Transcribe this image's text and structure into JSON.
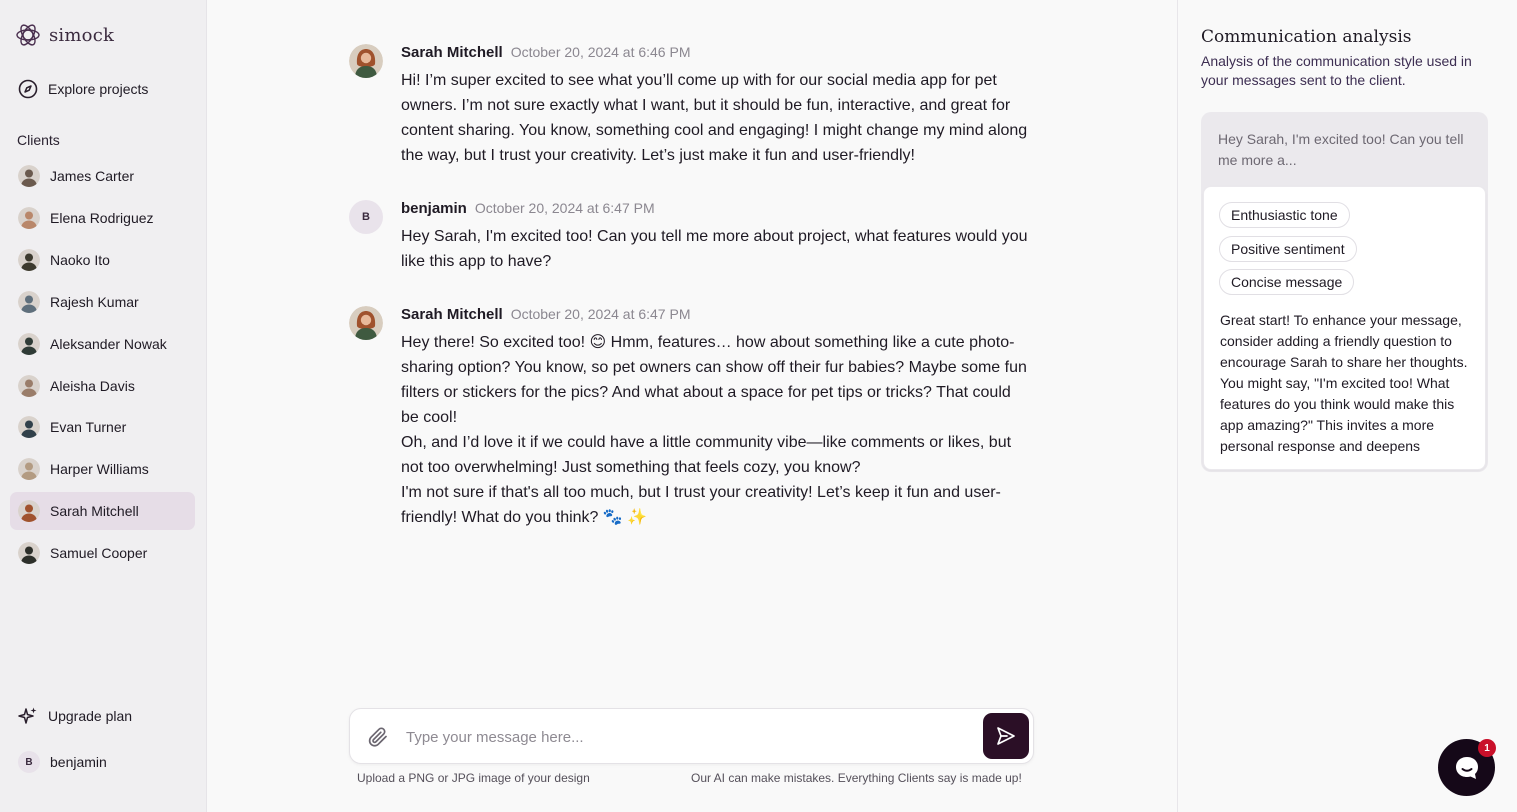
{
  "app": {
    "name": "simock"
  },
  "nav": {
    "explore": "Explore projects",
    "upgrade": "Upgrade plan",
    "user_initial": "B",
    "user_name": "benjamin"
  },
  "clients_label": "Clients",
  "clients": [
    {
      "name": "James Carter",
      "active": false,
      "color": "#6b5a4e"
    },
    {
      "name": "Elena Rodriguez",
      "active": false,
      "color": "#b9876a"
    },
    {
      "name": "Naoko Ito",
      "active": false,
      "color": "#3d3a2e"
    },
    {
      "name": "Rajesh Kumar",
      "active": false,
      "color": "#5f6f7c"
    },
    {
      "name": "Aleksander Nowak",
      "active": false,
      "color": "#2f3b36"
    },
    {
      "name": "Aleisha Davis",
      "active": false,
      "color": "#9a7d6a"
    },
    {
      "name": "Evan Turner",
      "active": false,
      "color": "#31404a"
    },
    {
      "name": "Harper Williams",
      "active": false,
      "color": "#b39b82"
    },
    {
      "name": "Sarah Mitchell",
      "active": true,
      "color": "#a0522d"
    },
    {
      "name": "Samuel Cooper",
      "active": false,
      "color": "#2d2f2a"
    }
  ],
  "messages": [
    {
      "sender": "Sarah Mitchell",
      "time": "October 20, 2024 at 6:46 PM",
      "avatar": "photo",
      "paragraphs": [
        "Hi! I’m super excited to see what you’ll come up with for our social media app for pet owners. I’m not sure exactly what I want, but it should be fun, interactive, and great for content sharing. You know, something cool and engaging! I might change my mind along the way, but I trust your creativity. Let’s just make it fun and user-friendly!"
      ]
    },
    {
      "sender": "benjamin",
      "time": "October 20, 2024 at 6:47 PM",
      "avatar": "initial",
      "initial": "B",
      "paragraphs": [
        "Hey Sarah, I'm excited too! Can you tell me more about project, what features would you like this app to have?"
      ]
    },
    {
      "sender": "Sarah Mitchell",
      "time": "October 20, 2024 at 6:47 PM",
      "avatar": "photo",
      "paragraphs": [
        "Hey there! So excited too! 😊 Hmm, features… how about something like a cute photo-sharing option? You know, so pet owners can show off their fur babies? Maybe some fun filters or stickers for the pics? And what about a space for pet tips or tricks? That could be cool!",
        "Oh, and I’d love it if we could have a little community vibe—like comments or likes, but not too overwhelming! Just something that feels cozy, you know?",
        "I'm not sure if that's all too much, but I trust your creativity! Let’s keep it fun and user-friendly! What do you think? 🐾 ✨"
      ]
    }
  ],
  "composer": {
    "placeholder": "Type your message here...",
    "hint_left": "Upload a PNG or JPG image of your design",
    "hint_right": "Our AI can make mistakes. Everything Clients say is made up!"
  },
  "analysis": {
    "title": "Communication analysis",
    "subtitle": "Analysis of the communication style used in your messages sent to the client.",
    "preview": "Hey Sarah, I'm excited too! Can you tell me more a...",
    "tags": [
      "Enthusiastic tone",
      "Positive sentiment",
      "Concise message"
    ],
    "feedback": "Great start! To enhance your message, consider adding a friendly question to encourage Sarah to share her thoughts. You might say, \"I'm excited too! What features do you think would make this app amazing?\" This invites a more personal response and deepens"
  },
  "chat_widget": {
    "badge": "1"
  },
  "colors": {
    "accent": "#2b0f26",
    "active_bg": "#e6dde7",
    "badge": "#c9102a"
  }
}
